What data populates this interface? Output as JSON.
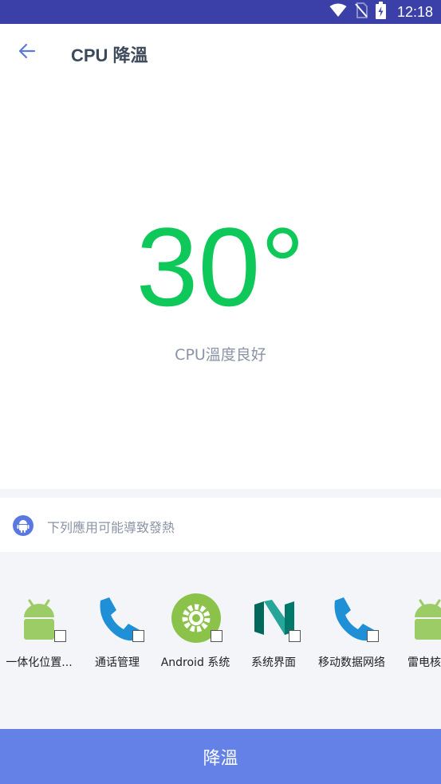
{
  "status_bar": {
    "time": "12:18",
    "icons": [
      "wifi-icon",
      "no-sim-icon",
      "battery-charging-icon"
    ]
  },
  "app_bar": {
    "back_icon": "arrow-left-icon",
    "title": "CPU 降溫"
  },
  "temperature": {
    "value": "30°",
    "status": "CPU溫度良好",
    "color": "#0fc85a"
  },
  "apps_section": {
    "header_icon": "android-icon",
    "header_text": "下列應用可能導致發熱",
    "apps": [
      {
        "label": "一体化位置...",
        "icon": "android-robot-icon",
        "checked": false
      },
      {
        "label": "通话管理",
        "icon": "phone-icon",
        "checked": false
      },
      {
        "label": "Android 系统",
        "icon": "android-settings-icon",
        "checked": false
      },
      {
        "label": "系统界面",
        "icon": "android-n-icon",
        "checked": false
      },
      {
        "label": "移动数据网络",
        "icon": "phone-icon",
        "checked": false
      },
      {
        "label": "雷电核心",
        "icon": "android-robot-icon",
        "checked": false
      }
    ]
  },
  "action": {
    "button_label": "降溫",
    "accent": "#6381e6"
  }
}
